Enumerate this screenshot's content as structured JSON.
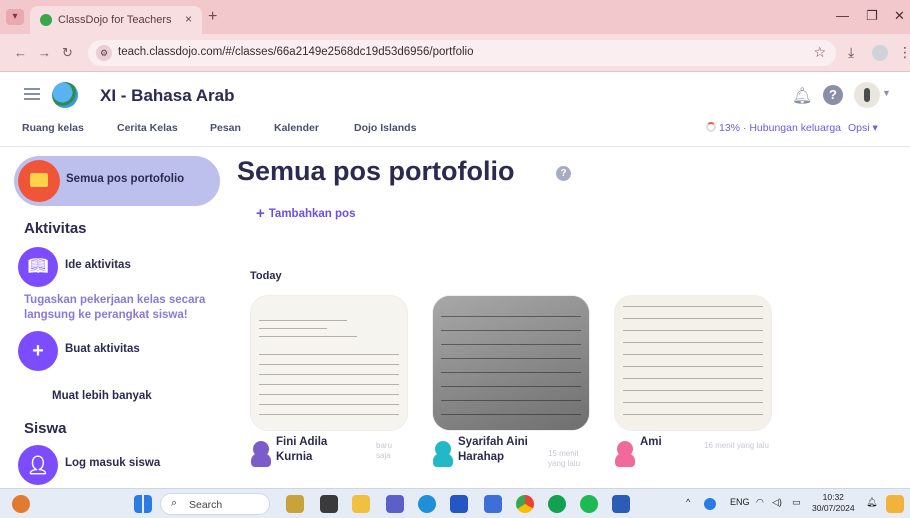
{
  "browser": {
    "tab_title": "ClassDojo for Teachers",
    "tab_close": "×",
    "new_tab": "+",
    "url": "teach.classdojo.com/#/classes/66a2149e2568dc19d53d6956/portfolio",
    "window_controls": {
      "minimize": "—",
      "maximize": "❐",
      "close": "✕"
    }
  },
  "header": {
    "class_title": "XI - Bahasa Arab",
    "nav": [
      "Ruang kelas",
      "Cerita Kelas",
      "Pesan",
      "Kalender",
      "Dojo Islands"
    ],
    "parents_connection": "13% · Hubungan keluarga",
    "options": "Opsi ▾"
  },
  "sidebar": {
    "active_item": "Semua pos portofolio",
    "section_activities": "Aktivitas",
    "item_ideas": "Ide aktivitas",
    "promo": "Tugaskan pekerjaan kelas secara langsung ke perangkat siswa!",
    "item_create": "Buat aktivitas",
    "more": "Muat lebih banyak",
    "section_students": "Siswa",
    "item_student_login": "Log masuk siswa"
  },
  "main": {
    "title": "Semua pos portofolio",
    "add_post": "Tambahkan pos",
    "day_label": "Today",
    "posts": [
      {
        "name": "Fini Adila Kurnia",
        "time": "baru saja",
        "avatar_color": "#7b5cc9"
      },
      {
        "name": "Syarifah Aini Harahap",
        "time": "15 menit yang lalu",
        "avatar_color": "#22b8c8"
      },
      {
        "name": "Ami",
        "time": "16 menit yang lalu",
        "avatar_color": "#f06a9a"
      }
    ]
  },
  "taskbar": {
    "search": "Search",
    "lang": "ENG",
    "time": "10:32",
    "date": "30/07/2024"
  },
  "colors": {
    "accent": "#6c4ee3",
    "active_bg": "#bdc0ec",
    "browser_tab": "#f2c8cc"
  }
}
